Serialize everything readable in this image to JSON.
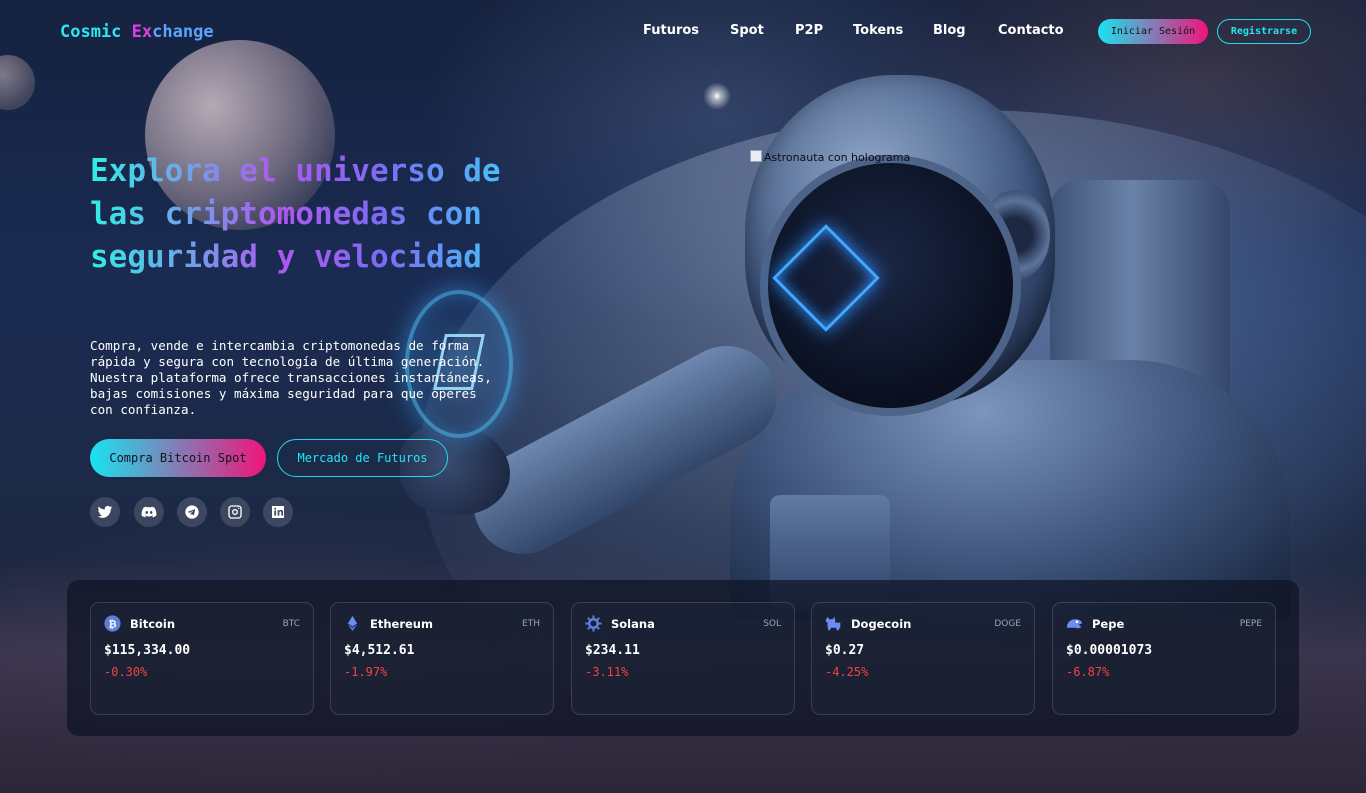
{
  "brand": {
    "part1": "Cosmic ",
    "part2": "Ex",
    "part3": "change"
  },
  "nav": {
    "links": [
      "Futuros",
      "Spot",
      "P2P",
      "Tokens",
      "Blog",
      "Contacto"
    ],
    "login_label": "Iniciar Sesión",
    "register_label": "Registrarse"
  },
  "hero": {
    "title": "Explora el universo de las criptomonedas con seguridad y velocidad",
    "description": "Compra, vende e intercambia criptomonedas de forma rápida y segura con tecnología de última generación. Nuestra plataforma ofrece transacciones instantáneas, bajas comisiones y máxima seguridad para que operes con confianza.",
    "primary_cta": "Compra Bitcoin Spot",
    "secondary_cta": "Mercado de Futuros",
    "image_alt": "Astronauta con holograma"
  },
  "socials": [
    "twitter-icon",
    "discord-icon",
    "telegram-icon",
    "instagram-icon",
    "linkedin-icon"
  ],
  "ticker": [
    {
      "name": "Bitcoin",
      "symbol": "BTC",
      "price": "$115,334.00",
      "change": "-0.30%",
      "icon": "bitcoin-icon"
    },
    {
      "name": "Ethereum",
      "symbol": "ETH",
      "price": "$4,512.61",
      "change": "-1.97%",
      "icon": "ethereum-icon"
    },
    {
      "name": "Solana",
      "symbol": "SOL",
      "price": "$234.11",
      "change": "-3.11%",
      "icon": "solana-icon"
    },
    {
      "name": "Dogecoin",
      "symbol": "DOGE",
      "price": "$0.27",
      "change": "-4.25%",
      "icon": "dogecoin-icon"
    },
    {
      "name": "Pepe",
      "symbol": "PEPE",
      "price": "$0.00001073",
      "change": "-6.87%",
      "icon": "pepe-icon"
    }
  ],
  "colors": {
    "accent_cyan": "#22e5f0",
    "accent_magenta": "#f0147a",
    "negative": "#ef4444"
  }
}
